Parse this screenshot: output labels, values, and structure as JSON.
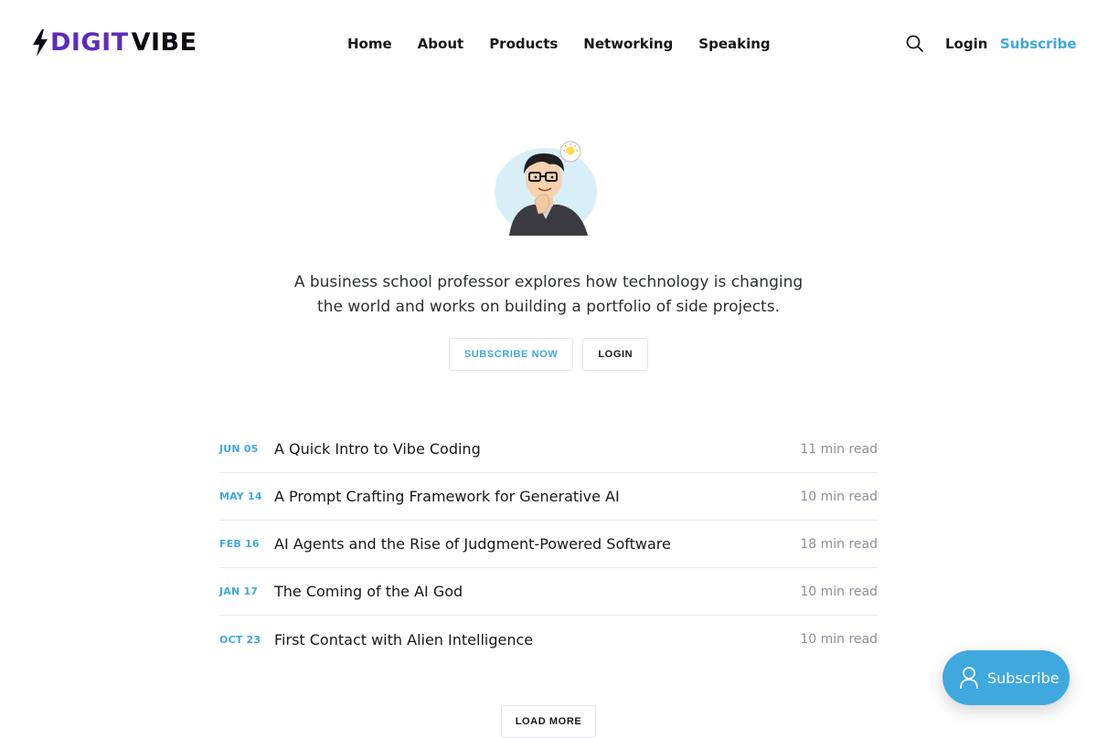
{
  "brand": {
    "logo_part1": "DIGIT",
    "logo_part2": "VIBE",
    "accent_color": "#3fa8de"
  },
  "nav": {
    "items": [
      {
        "label": "Home"
      },
      {
        "label": "About"
      },
      {
        "label": "Products"
      },
      {
        "label": "Networking"
      },
      {
        "label": "Speaking"
      }
    ],
    "login_label": "Login",
    "subscribe_label": "Subscribe",
    "search_icon": "search-icon"
  },
  "hero": {
    "tagline_line1": "A business school professor explores how technology is changing",
    "tagline_line2": "the world and works on building a portfolio of side projects.",
    "subscribe_button": "SUBSCRIBE NOW",
    "login_button": "LOGIN"
  },
  "posts": [
    {
      "date": "JUN 05",
      "title": "A Quick Intro to Vibe Coding",
      "read_time": "11 min read"
    },
    {
      "date": "MAY 14",
      "title": "A Prompt Crafting Framework for Generative AI",
      "read_time": "10 min read"
    },
    {
      "date": "FEB 16",
      "title": "AI Agents and the Rise of Judgment-Powered Software",
      "read_time": "18 min read"
    },
    {
      "date": "JAN 17",
      "title": "The Coming of the AI God",
      "read_time": "10 min read"
    },
    {
      "date": "OCT 23",
      "title": "First Contact with Alien Intelligence",
      "read_time": "10 min read"
    }
  ],
  "load_more_label": "LOAD MORE",
  "portal": {
    "label": "Subscribe",
    "icon": "user-icon"
  }
}
